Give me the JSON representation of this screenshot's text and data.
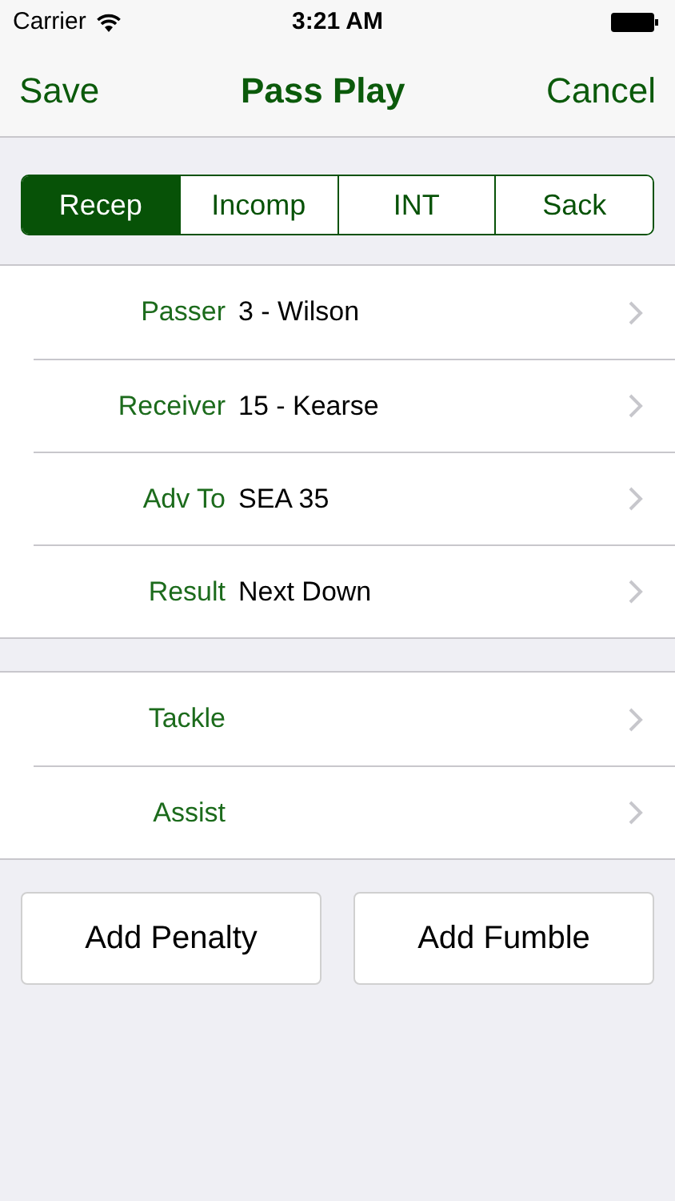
{
  "status_bar": {
    "carrier": "Carrier",
    "time": "3:21 AM"
  },
  "nav_bar": {
    "left_button": "Save",
    "title": "Pass Play",
    "right_button": "Cancel"
  },
  "segments": [
    {
      "label": "Recep",
      "selected": true
    },
    {
      "label": "Incomp",
      "selected": false
    },
    {
      "label": "INT",
      "selected": false
    },
    {
      "label": "Sack",
      "selected": false
    }
  ],
  "sections": [
    {
      "rows": [
        {
          "label": "Passer",
          "value": "3 - Wilson"
        },
        {
          "label": "Receiver",
          "value": "15 - Kearse"
        },
        {
          "label": "Adv To",
          "value": "SEA 35"
        },
        {
          "label": "Result",
          "value": "Next Down"
        }
      ]
    },
    {
      "rows": [
        {
          "label": "Tackle"
        },
        {
          "label": "Assist"
        }
      ]
    }
  ],
  "buttons": [
    "Add Penalty",
    "Add Fumble"
  ]
}
